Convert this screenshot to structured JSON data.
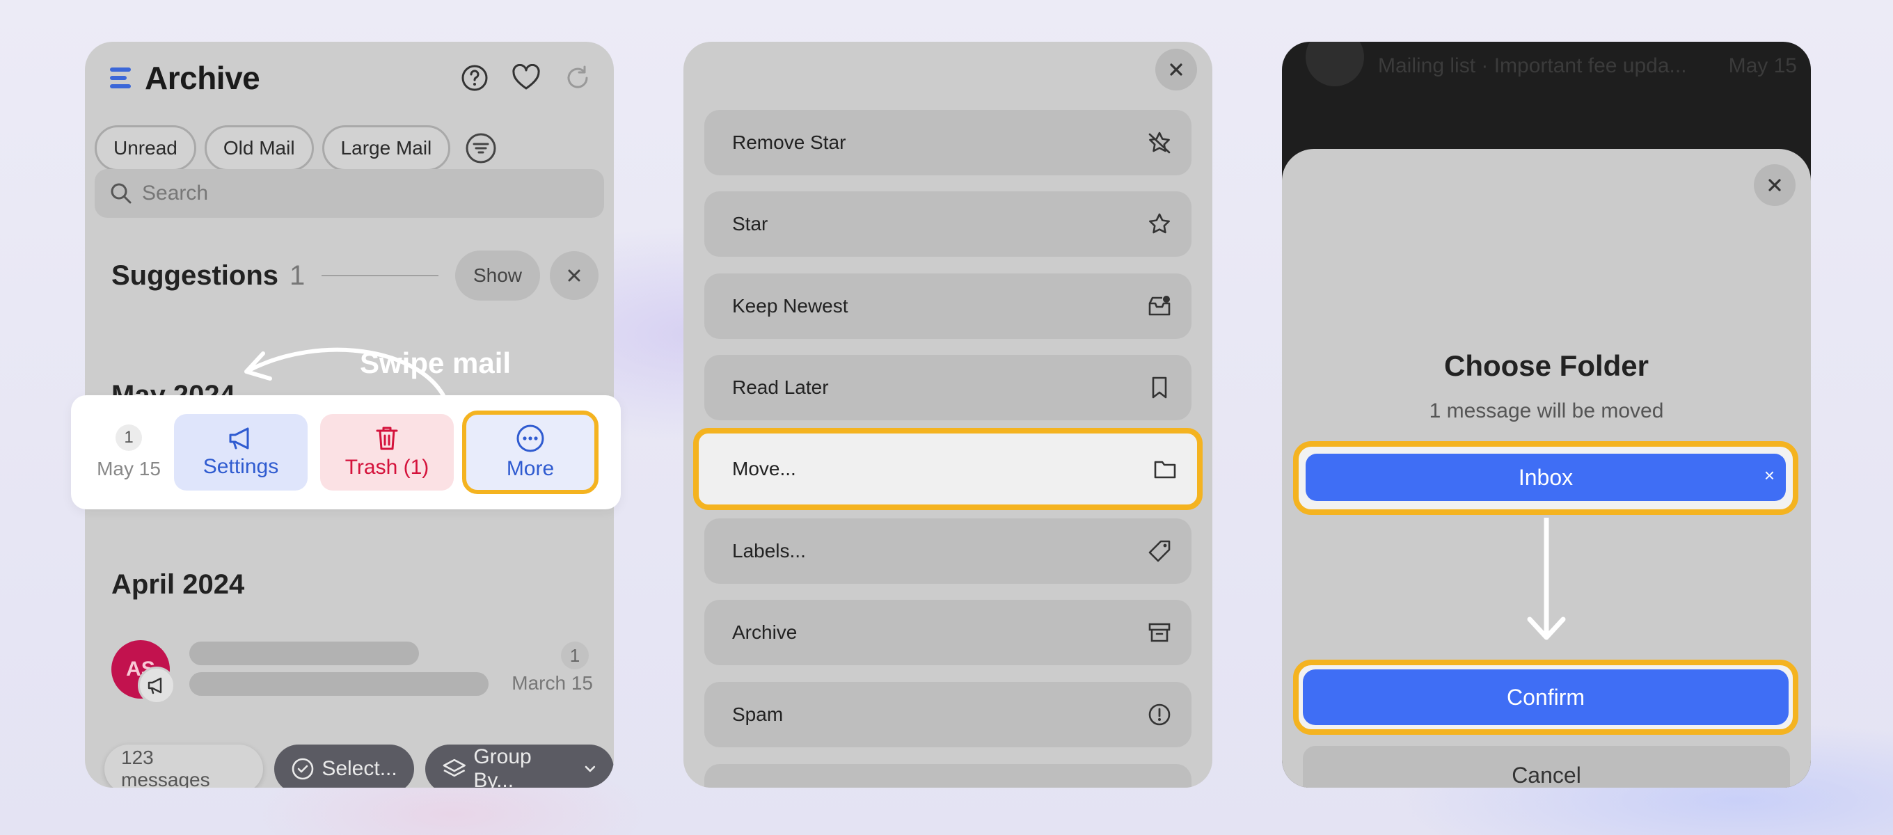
{
  "colors": {
    "accent_blue": "#3f6ef5",
    "highlight_yellow": "#f4b320",
    "trash_red": "#d4123b",
    "avatar_pink": "#c2124e"
  },
  "list_panel": {
    "title": "Archive",
    "header_icons": [
      "help-icon",
      "heart-icon",
      "refresh-icon"
    ],
    "filters": [
      "Unread",
      "Old Mail",
      "Large Mail"
    ],
    "search_placeholder": "Search",
    "suggestions": {
      "title": "Suggestions",
      "count": "1",
      "show_label": "Show"
    },
    "month_may": "May 2024",
    "swipe_hint": "Swipe mail",
    "swipe_row": {
      "count": "1",
      "date": "May 15",
      "actions": {
        "settings": "Settings",
        "trash": "Trash (1)",
        "more": "More"
      }
    },
    "month_april": "April 2024",
    "april_row": {
      "avatar_initials": "AS",
      "count": "1",
      "date": "March 15"
    },
    "bottom": {
      "messages": "123 messages",
      "select": "Select...",
      "group_by": "Group By..."
    }
  },
  "menu_panel": {
    "items": [
      {
        "label": "Remove Star",
        "icon": "star-off-icon"
      },
      {
        "label": "Star",
        "icon": "star-icon"
      },
      {
        "label": "Keep Newest",
        "icon": "inbox-keep-icon"
      },
      {
        "label": "Read Later",
        "icon": "bookmark-icon"
      },
      {
        "label": "Move...",
        "icon": "folder-icon",
        "highlighted": true
      },
      {
        "label": "Labels...",
        "icon": "tag-icon"
      },
      {
        "label": "Archive",
        "icon": "archive-icon"
      },
      {
        "label": "Spam",
        "icon": "alert-circle-icon"
      }
    ]
  },
  "folder_panel": {
    "background_row": {
      "text": "Mailing list · Important fee upda...",
      "date": "May 15"
    },
    "title": "Choose Folder",
    "subtitle": "1 message will be moved",
    "selected_folder": "Inbox",
    "confirm": "Confirm",
    "cancel": "Cancel"
  }
}
